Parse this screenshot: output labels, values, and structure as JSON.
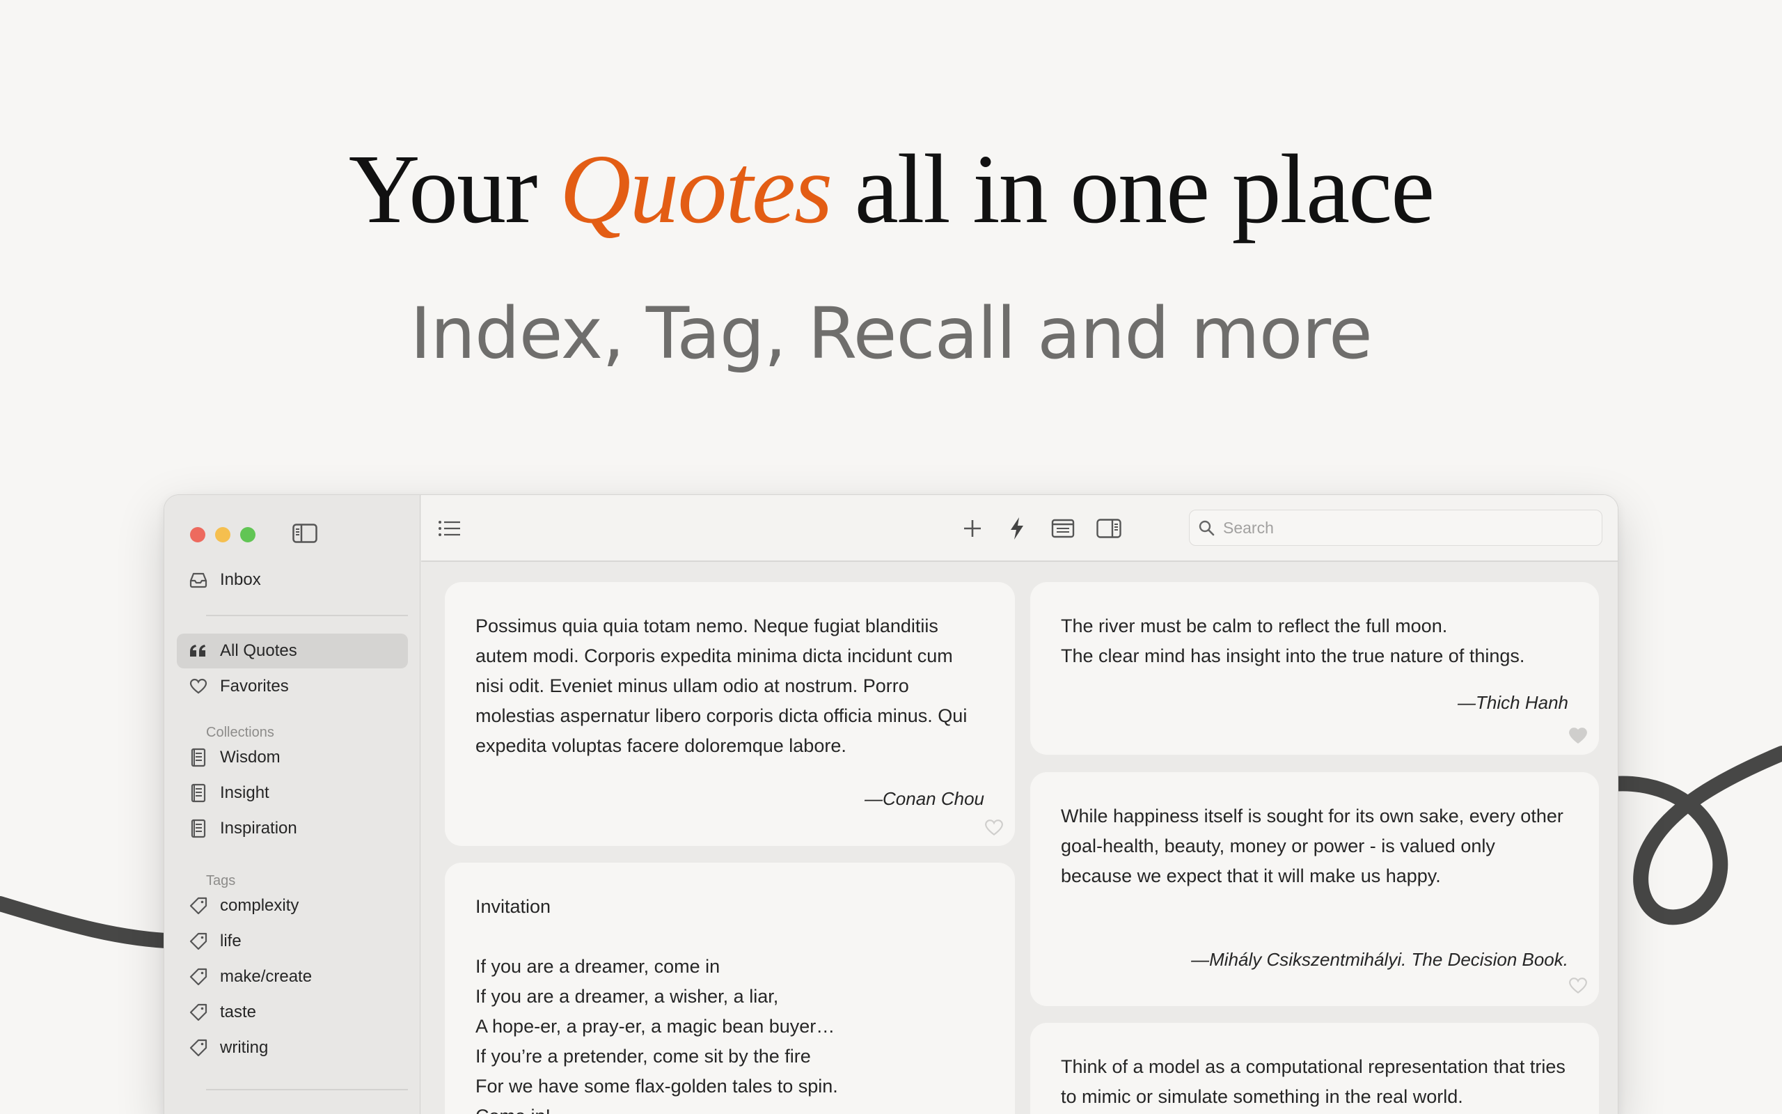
{
  "headline": {
    "before": "Your ",
    "accent": "Quotes",
    "after": " all in one place"
  },
  "subheadline": "Index, Tag, Recall and more",
  "colors": {
    "accent": "#e35d14",
    "curve": "#474746"
  },
  "window": {
    "sidebar": {
      "inbox": "Inbox",
      "all_quotes": "All Quotes",
      "favorites": "Favorites",
      "collections_header": "Collections",
      "collections": [
        "Wisdom",
        "Insight",
        "Inspiration"
      ],
      "tags_header": "Tags",
      "tags": [
        "complexity",
        "life",
        "make/create",
        "taste",
        "writing"
      ]
    },
    "toolbar": {
      "icons": [
        "list-icon",
        "plus-icon",
        "lightning-icon",
        "card-view-icon",
        "inspector-toggle-icon"
      ],
      "search_placeholder": "Search"
    },
    "quotes": [
      {
        "text": "Possimus quia quia totam nemo. Neque fugiat blanditiis autem modi. Corporis expedita minima dicta incidunt cum nisi odit. Eveniet minus ullam odio at nostrum. Porro molestias aspernatur libero corporis dicta officia minus. Qui expedita voluptas facere doloremque labore.",
        "author": "—Conan Chou",
        "favorite": false
      },
      {
        "text": "Invitation\n\nIf you are a dreamer, come in\nIf you are a dreamer, a wisher, a liar,\nA hope-er, a pray-er, a magic bean buyer…\nIf you’re a pretender, come sit by the fire\nFor we have some flax-golden tales to spin.\nCome in!",
        "author": "",
        "favorite": false
      },
      {
        "text": "The river must be calm to reflect the full moon.\nThe clear mind has insight into the true nature of things.",
        "author": "—Thich Hanh",
        "favorite": true
      },
      {
        "text": "While happiness itself is sought for its own sake, every other goal-health, beauty, money or power - is valued only because we expect that it will make us happy.",
        "author": "—Mihály Csikszentmihályi. The Decision Book.",
        "favorite": false
      },
      {
        "text": "Think of a model as a computational representation that tries to mimic or simulate something in the real world.",
        "author": "",
        "favorite": false
      }
    ]
  }
}
